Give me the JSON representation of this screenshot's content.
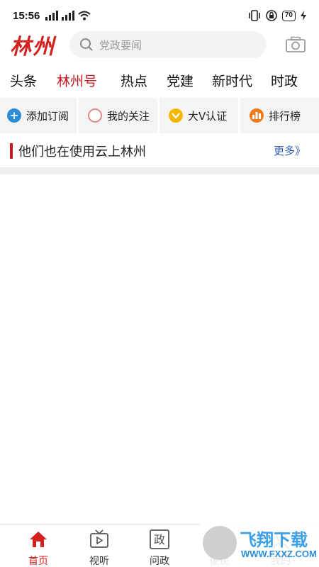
{
  "status_bar": {
    "time": "15:56",
    "battery": "70"
  },
  "header": {
    "logo": "林州",
    "search_placeholder": "党政要闻"
  },
  "tabs": [
    "头条",
    "林州号",
    "热点",
    "党建",
    "新时代",
    "时政"
  ],
  "active_tab": "林州号",
  "actions": [
    {
      "label": "添加订阅",
      "icon": "plus-circle-icon",
      "color": "#2b8ed6"
    },
    {
      "label": "我的关注",
      "icon": "ring-icon",
      "color": "#e58a8a"
    },
    {
      "label": "大V认证",
      "icon": "check-v-icon",
      "color": "#f5b800"
    },
    {
      "label": "排行榜",
      "icon": "rank-bars-icon",
      "color": "#ef7b1a"
    }
  ],
  "section": {
    "title": "他们也在使用云上林州",
    "more": "更多》"
  },
  "bottom_nav": [
    {
      "label": "首页",
      "icon": "home-icon",
      "active": true
    },
    {
      "label": "视听",
      "icon": "tv-icon",
      "active": false
    },
    {
      "label": "问政",
      "icon": "zheng-icon",
      "active": false
    },
    {
      "label": "便民",
      "icon": "service-icon",
      "active": false
    },
    {
      "label": "我的",
      "icon": "user-icon",
      "active": false
    }
  ],
  "watermark": {
    "text": "飞翔下载",
    "url": "WWW.FXXZ.COM"
  },
  "colors": {
    "accent": "#c8181f",
    "link": "#2e5fb3"
  }
}
